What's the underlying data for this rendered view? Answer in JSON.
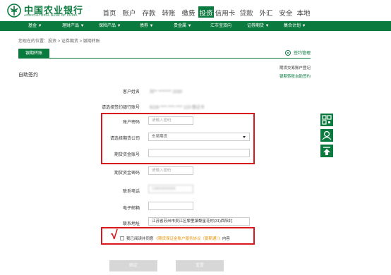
{
  "bank": {
    "name_cn": "中国农业银行",
    "name_en": "AGRICULTURAL BANK OF CHINA"
  },
  "top_nav": [
    "首页",
    "账户",
    "存款",
    "转账",
    "缴费",
    "投资",
    "信用卡",
    "贷款",
    "外汇",
    "安全",
    "本地"
  ],
  "top_nav_active": "投资",
  "sub_nav": [
    "基金 ▼",
    "理财产品 ▼",
    "保险产品 ▼",
    "债券 ▼",
    "贵金属 ▼",
    "汇市宝双向",
    "证券期货 ▼",
    "集合计划 ▼"
  ],
  "breadcrumb": "您现在的位置：投资 > 证券期货 > 银期转账",
  "tab_label": "银期转账",
  "manage_link": "签约管理",
  "side_links": [
    "期货交易账户登记",
    "银期转账自助签约"
  ],
  "section_title": "自助签约",
  "form": {
    "account_name_label": "客户姓名",
    "account_name_value": "刘**  ******** 2030",
    "sign_account_label": "请选择签约银行账号",
    "sign_account_value": "6228 **** **** **** 123 借记卡",
    "account_password_label": "账户密码",
    "account_password_placeholder": "请输入密码",
    "futures_company_label": "请选择期货公司",
    "futures_company_value": "东吴期货",
    "futures_account_label": "期货资金账号",
    "futures_account_value": "",
    "futures_password_label": "期货资金密码",
    "futures_password_placeholder": "请输入密码",
    "phone_label": "联系电话",
    "phone_value": "13800000000",
    "email_label": "电子邮箱",
    "email_value": "",
    "address_label": "联系地址",
    "address_value": "江苏省苏州市吴江区黎里镇黎星花村(31)西阳北"
  },
  "agreement": {
    "prefix": "我已阅读并同意",
    "link": "《期货保证金账户服务协议（银期通）》",
    "suffix": "内容"
  },
  "buttons": {
    "submit": "确定",
    "reset": "重置"
  },
  "colors": {
    "brand_green": "#0b7a3e",
    "highlight_red": "#d9181e",
    "link_orange": "#e8930c"
  }
}
